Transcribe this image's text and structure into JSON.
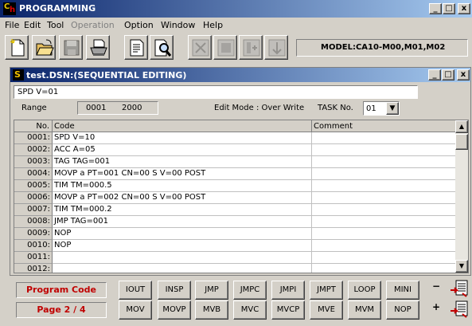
{
  "app": {
    "title": "PROGRAMMING",
    "logo_text_c": "C",
    "logo_text_h": "h",
    "caption_buttons": {
      "minimize": "_",
      "maximize": "□",
      "close": "x"
    }
  },
  "menu": [
    {
      "label": "File",
      "enabled": true
    },
    {
      "label": "Edit",
      "enabled": true
    },
    {
      "label": "Tool",
      "enabled": true
    },
    {
      "label": "Operation",
      "enabled": false
    },
    {
      "label": "Option",
      "enabled": true
    },
    {
      "label": "Window",
      "enabled": true
    },
    {
      "label": "Help",
      "enabled": true
    }
  ],
  "toolbar": {
    "model_label": "MODEL:CA10-M00,M01,M02",
    "buttons": [
      "new-icon",
      "open-icon",
      "save-icon",
      "print-icon",
      "edit-document-icon",
      "search-icon",
      "copy-icon",
      "cut-icon",
      "paste-icon",
      "insert-icon"
    ]
  },
  "editor": {
    "title": "test.DSN:(SEQUENTIAL EDITING)",
    "icon_letter": "S",
    "speed_field": "SPD V=01",
    "range_label": "Range",
    "range_start": "0001",
    "range_end": "2000",
    "edit_mode": "Edit Mode : Over Write",
    "task_label": "TASK No.",
    "task_value": "01",
    "columns": {
      "no": "No.",
      "code": "Code",
      "comment": "Comment"
    },
    "rows": [
      {
        "no": "0001:",
        "code": "SPD V=10",
        "comment": ""
      },
      {
        "no": "0002:",
        "code": "ACC A=05",
        "comment": ""
      },
      {
        "no": "0003:",
        "code": "TAG TAG=001",
        "comment": ""
      },
      {
        "no": "0004:",
        "code": "MOVP a PT=001 CN=00 S V=00 POST",
        "comment": ""
      },
      {
        "no": "0005:",
        "code": "TIM TM=000.5",
        "comment": ""
      },
      {
        "no": "0006:",
        "code": "MOVP a PT=002 CN=00 S V=00 POST",
        "comment": ""
      },
      {
        "no": "0007:",
        "code": "TIM TM=000.2",
        "comment": ""
      },
      {
        "no": "0008:",
        "code": "JMP TAG=001",
        "comment": ""
      },
      {
        "no": "0009:",
        "code": "NOP",
        "comment": ""
      },
      {
        "no": "0010:",
        "code": "NOP",
        "comment": ""
      },
      {
        "no": "0011:",
        "code": "",
        "comment": ""
      },
      {
        "no": "0012:",
        "code": "",
        "comment": ""
      }
    ]
  },
  "bottom": {
    "program_code_label": "Program Code",
    "page_label": "Page 2 / 4",
    "row1": [
      "IOUT",
      "INSP",
      "JMP",
      "JMPC",
      "JMPI",
      "JMPT",
      "LOOP",
      "MINI"
    ],
    "row2": [
      "MOV",
      "MOVP",
      "MVB",
      "MVC",
      "MVCP",
      "MVE",
      "MVM",
      "NOP"
    ],
    "minus": "−",
    "plus": "+"
  }
}
